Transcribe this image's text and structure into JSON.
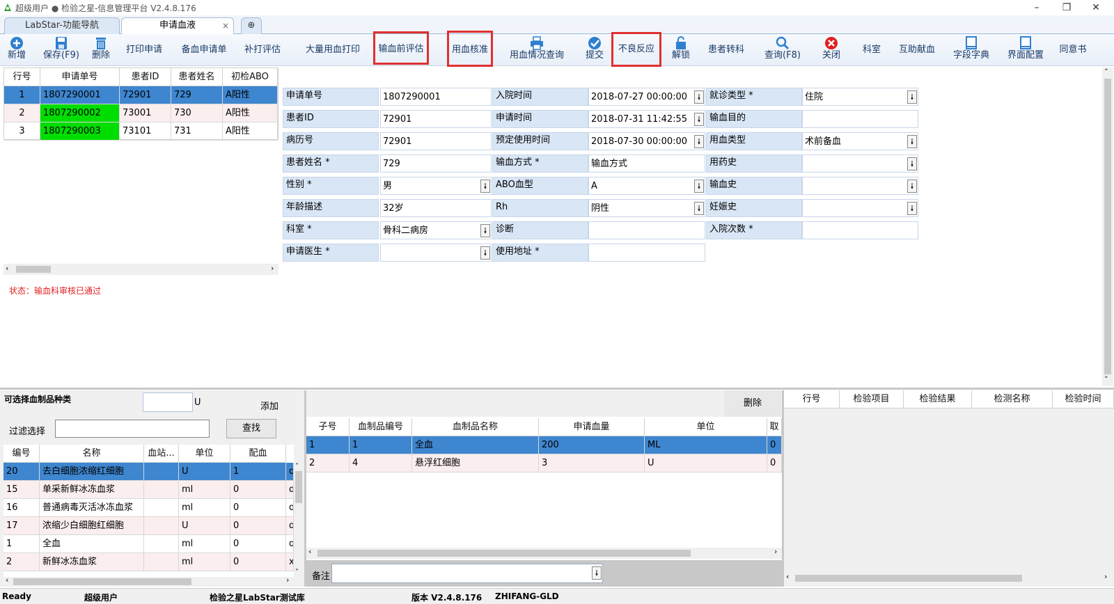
{
  "window": {
    "title": "超级用户 ● 检验之星-信息管理平台  V2.4.8.176"
  },
  "tabs": [
    {
      "label": "LabStar-功能导航"
    },
    {
      "label": "申请血液",
      "close": "×"
    }
  ],
  "toolbar": {
    "items": [
      {
        "label": "新增"
      },
      {
        "label": "保存(F9)"
      },
      {
        "label": "删除"
      },
      {
        "label": "打印申请"
      },
      {
        "label": "备血申请单"
      },
      {
        "label": "补打评估"
      },
      {
        "label": "大量用血打印"
      },
      {
        "label": "输血前评估"
      },
      {
        "label": "用血核准"
      },
      {
        "label": "用血情况查询"
      },
      {
        "label": "提交"
      },
      {
        "label": "不良反应"
      },
      {
        "label": "解锁"
      },
      {
        "label": "患者转科"
      },
      {
        "label": "查询(F8)"
      },
      {
        "label": "关闭"
      },
      {
        "label": "科室"
      },
      {
        "label": "互助献血"
      },
      {
        "label": "字段字典"
      },
      {
        "label": "界面配置"
      },
      {
        "label": "同意书"
      }
    ]
  },
  "request_grid": {
    "headers": [
      "行号",
      "申请单号",
      "患者ID",
      "患者姓名",
      "初检ABO"
    ],
    "rows": [
      [
        "1",
        "1807290001",
        "72901",
        "729",
        "A阳性"
      ],
      [
        "2",
        "1807290002",
        "73001",
        "730",
        "A阳性"
      ],
      [
        "3",
        "1807290003",
        "73101",
        "731",
        "A阳性"
      ]
    ]
  },
  "status_text": "状态：输血科审核已通过",
  "form": {
    "col1": [
      {
        "label": "申请单号",
        "value": "1807290001",
        "dropdown": false
      },
      {
        "label": "患者ID",
        "value": "72901",
        "dropdown": false
      },
      {
        "label": "病历号",
        "value": "72901",
        "dropdown": false
      },
      {
        "label": "患者姓名 *",
        "value": "729",
        "dropdown": false
      },
      {
        "label": "性别 *",
        "value": "男",
        "dropdown": true
      },
      {
        "label": "年龄描述",
        "value": "32岁",
        "dropdown": false
      },
      {
        "label": "科室 *",
        "value": "骨科二病房",
        "dropdown": true
      },
      {
        "label": "申请医生 *",
        "value": "",
        "dropdown": true
      }
    ],
    "col2": [
      {
        "label": "入院时间",
        "value": "2018-07-27 00:00:00",
        "dropdown": true
      },
      {
        "label": "申请时间",
        "value": "2018-07-31 11:42:55",
        "dropdown": true
      },
      {
        "label": "预定使用时间",
        "value": "2018-07-30 00:00:00",
        "dropdown": true
      },
      {
        "label": "输血方式 *",
        "value": "输血方式",
        "dropdown": false
      },
      {
        "label": "ABO血型",
        "value": "A",
        "dropdown": true
      },
      {
        "label": "Rh",
        "value": "阴性",
        "dropdown": true
      },
      {
        "label": "诊断",
        "value": "",
        "dropdown": false
      },
      {
        "label": "使用地址 *",
        "value": "",
        "dropdown": false
      }
    ],
    "col3": [
      {
        "label": "就诊类型 *",
        "value": "住院",
        "dropdown": true
      },
      {
        "label": "输血目的",
        "value": "",
        "dropdown": false
      },
      {
        "label": "用血类型",
        "value": "术前备血",
        "dropdown": true
      },
      {
        "label": "用药史",
        "value": "",
        "dropdown": true
      },
      {
        "label": "输血史",
        "value": "",
        "dropdown": true
      },
      {
        "label": "妊娠史",
        "value": "",
        "dropdown": true
      },
      {
        "label": "入院次数 *",
        "value": "",
        "dropdown": false
      }
    ]
  },
  "product_panel": {
    "title": "可选择血制品种类",
    "unit": "U",
    "add_label": "添加",
    "filter_label": "过滤选择",
    "search_label": "查找",
    "headers": [
      "编号",
      "名称",
      "血站...",
      "单位",
      "配血"
    ],
    "rows": [
      [
        "20",
        "去白细胞浓缩红细胞",
        "",
        "U",
        "1",
        "ql"
      ],
      [
        "15",
        "单采新鲜冰冻血浆",
        "",
        "ml",
        "0",
        "dc"
      ],
      [
        "16",
        "普通病毒灭活冰冻血浆",
        "",
        "ml",
        "0",
        "dc"
      ],
      [
        "17",
        "浓缩少白细胞红细胞",
        "",
        "U",
        "0",
        "dc"
      ],
      [
        "1",
        "全血",
        "",
        "ml",
        "0",
        "qx"
      ],
      [
        "2",
        "新鲜冰冻血浆",
        "",
        "ml",
        "0",
        "xx"
      ]
    ]
  },
  "detail_panel": {
    "delete_label": "删除",
    "headers": [
      "子号",
      "血制品编号",
      "血制品名称",
      "申请血量",
      "单位",
      "取"
    ],
    "rows": [
      [
        "1",
        "1",
        "全血",
        "200",
        "ML",
        "0"
      ],
      [
        "2",
        "4",
        "悬浮红细胞",
        "3",
        "U",
        "0"
      ]
    ],
    "remark_label": "备注"
  },
  "result_panel": {
    "headers": [
      "行号",
      "检验项目",
      "检验结果",
      "检测名称",
      "检验时间"
    ]
  },
  "statusbar": {
    "ready": "Ready",
    "user": "超级用户",
    "db": "检验之星LabStar测试库",
    "version": "版本 V2.4.8.176",
    "host": "ZHIFANG-GLD"
  }
}
